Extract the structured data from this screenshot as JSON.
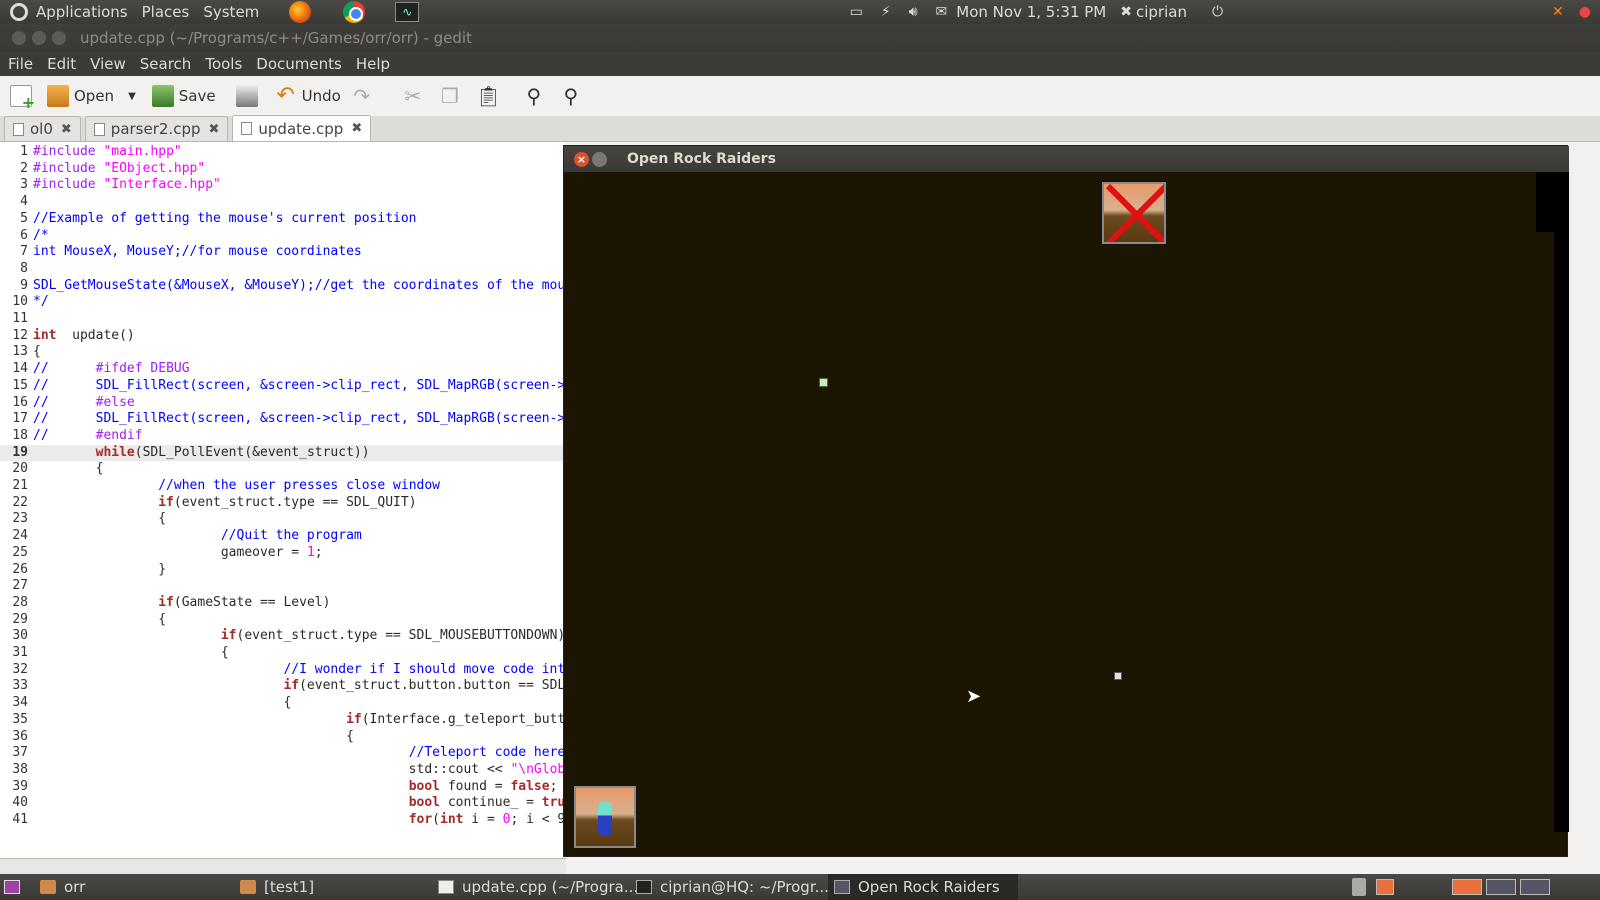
{
  "top_panel": {
    "menus": [
      "Applications",
      "Places",
      "System"
    ],
    "clock": "Mon Nov 1,  5:31 PM",
    "user": "ciprian"
  },
  "gedit": {
    "title": "update.cpp (~/Programs/c++/Games/orr/orr) - gedit",
    "menu": [
      "File",
      "Edit",
      "View",
      "Search",
      "Tools",
      "Documents",
      "Help"
    ],
    "toolbar": {
      "open": "Open",
      "save": "Save",
      "undo": "Undo"
    },
    "tabs": [
      "ol0",
      "parser2.cpp",
      "update.cpp"
    ],
    "active_tab": 2,
    "current_line": 19,
    "lines": [
      [
        [
          "pp",
          "#include "
        ],
        [
          "str",
          "\"main.hpp\""
        ]
      ],
      [
        [
          "pp",
          "#include "
        ],
        [
          "str",
          "\"EObject.hpp\""
        ]
      ],
      [
        [
          "pp",
          "#include "
        ],
        [
          "str",
          "\"Interface.hpp\""
        ]
      ],
      [],
      [
        [
          "cm",
          "//Example of getting the mouse's current position"
        ]
      ],
      [
        [
          "cm",
          "/*"
        ]
      ],
      [
        [
          "cm",
          "int MouseX, MouseY;//for mouse coordinates"
        ]
      ],
      [],
      [
        [
          "cm",
          "SDL_GetMouseState(&MouseX, &MouseY);//get the coordinates of the mouse"
        ]
      ],
      [
        [
          "cm",
          "*/"
        ]
      ],
      [],
      [
        [
          "kw",
          "int"
        ],
        [
          "",
          "  update()"
        ]
      ],
      [
        [
          "",
          "{"
        ]
      ],
      [
        [
          "cm",
          "//      "
        ],
        [
          "pp",
          "#ifdef DEBUG"
        ]
      ],
      [
        [
          "cm",
          "//      SDL_FillRect(screen, &screen->clip_rect, SDL_MapRGB(screen->format"
        ]
      ],
      [
        [
          "cm",
          "//      "
        ],
        [
          "pp",
          "#else"
        ]
      ],
      [
        [
          "cm",
          "//      SDL_FillRect(screen, &screen->clip_rect, SDL_MapRGB(screen->format"
        ]
      ],
      [
        [
          "cm",
          "//      "
        ],
        [
          "pp",
          "#endif"
        ]
      ],
      [
        [
          "",
          "        "
        ],
        [
          "kw",
          "while"
        ],
        [
          "",
          "(SDL_PollEvent(&event_struct))"
        ]
      ],
      [
        [
          "",
          "        {"
        ]
      ],
      [
        [
          "",
          "                "
        ],
        [
          "cm",
          "//when the user presses close window"
        ]
      ],
      [
        [
          "",
          "                "
        ],
        [
          "kw",
          "if"
        ],
        [
          "",
          "(event_struct.type == SDL_QUIT)"
        ]
      ],
      [
        [
          "",
          "                {"
        ]
      ],
      [
        [
          "",
          "                        "
        ],
        [
          "cm",
          "//Quit the program"
        ]
      ],
      [
        [
          "",
          "                        gameover = "
        ],
        [
          "num",
          "1"
        ],
        [
          "",
          ";"
        ]
      ],
      [
        [
          "",
          "                }"
        ]
      ],
      [],
      [
        [
          "",
          "                "
        ],
        [
          "kw",
          "if"
        ],
        [
          "",
          "(GameState == Level)"
        ]
      ],
      [
        [
          "",
          "                {"
        ]
      ],
      [
        [
          "",
          "                        "
        ],
        [
          "kw",
          "if"
        ],
        [
          "",
          "(event_struct.type == SDL_MOUSEBUTTONDOWN)"
        ]
      ],
      [
        [
          "",
          "                        {"
        ]
      ],
      [
        [
          "",
          "                                "
        ],
        [
          "cm",
          "//I wonder if I should move code into"
        ]
      ],
      [
        [
          "",
          "                                "
        ],
        [
          "kw",
          "if"
        ],
        [
          "",
          "(event_struct.button.button == SDL_"
        ]
      ],
      [
        [
          "",
          "                                {"
        ]
      ],
      [
        [
          "",
          "                                        "
        ],
        [
          "kw",
          "if"
        ],
        [
          "",
          "(Interface.g_teleport_button"
        ]
      ],
      [
        [
          "",
          "                                        {"
        ]
      ],
      [
        [
          "",
          "                                                "
        ],
        [
          "cm",
          "//Teleport code here"
        ]
      ],
      [
        [
          "",
          "                                                std::cout << "
        ],
        [
          "str",
          "\"\\nGlobal"
        ]
      ],
      [
        [
          "",
          "                                                "
        ],
        [
          "kw",
          "bool"
        ],
        [
          "",
          " found = "
        ],
        [
          "kw",
          "false"
        ],
        [
          "",
          ";"
        ]
      ],
      [
        [
          "",
          "                                                "
        ],
        [
          "kw",
          "bool"
        ],
        [
          "",
          " continue_ = "
        ],
        [
          "kw",
          "true"
        ],
        [
          "",
          ";"
        ]
      ],
      [
        [
          "",
          "                                                "
        ],
        [
          "kw",
          "for"
        ],
        [
          "",
          "("
        ],
        [
          "kw",
          "int"
        ],
        [
          "",
          " i = "
        ],
        [
          "num",
          "0"
        ],
        [
          "",
          "; i < 9"
        ]
      ]
    ]
  },
  "game_window": {
    "title": "Open Rock Raiders"
  },
  "bottom_panel": {
    "tasks": [
      "orr",
      "[test1]",
      "update.cpp (~/Progra...",
      "ciprian@HQ: ~/Progr...",
      "Open Rock Raiders"
    ],
    "active_task": 4
  }
}
